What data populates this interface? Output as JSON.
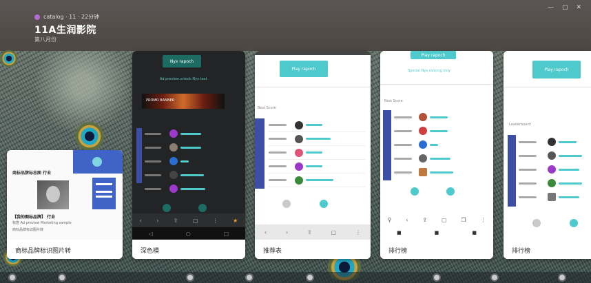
{
  "header": {
    "meta": "catalog · 11 · 22分钟",
    "title": "11A生润影院",
    "subtitle": "第八月份"
  },
  "cards": [
    {
      "caption": "商标品牌标识图片转",
      "headline": "商标品牌标志图 行业",
      "body_line1": "【我的图标品牌】 行业",
      "body_line2": "标签 Ad preview Marketing sample",
      "body_line3": "商标品牌标识图片转"
    },
    {
      "caption": "深色模",
      "button": "Nyx rapoch",
      "link": "Ad preview unlock Nyx text",
      "banner": "PROMO BANNER"
    },
    {
      "caption": "推荐表",
      "button": "Play rapoch",
      "section": "Best Score"
    },
    {
      "caption": "排行榜",
      "button": "Play rapoch",
      "link": "Special Nyx ranking only",
      "section": "Best Score"
    },
    {
      "caption": "排行榜",
      "button": "Play rapoch",
      "section": "Leaderboard"
    }
  ],
  "colors": {
    "accent": "#4ec9cc",
    "rail": "#3d4ea5",
    "topbar": "#4d4744"
  }
}
